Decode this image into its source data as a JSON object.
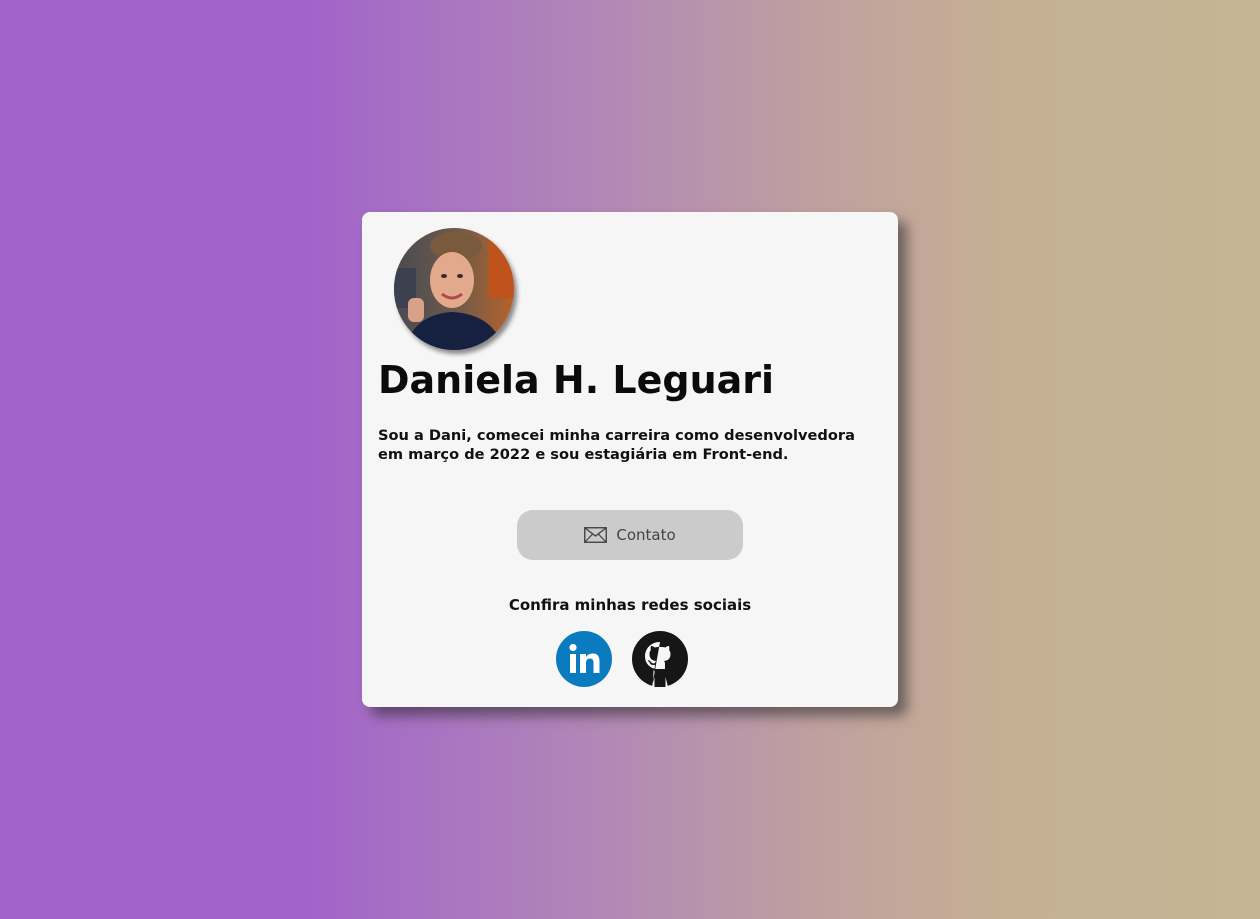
{
  "profile": {
    "name": "Daniela H. Leguari",
    "bio": "Sou a Dani, comecei minha carreira como desenvolvedora em março de 2022 e sou estagiária em Front-end.",
    "avatar_alt": "profile-photo"
  },
  "contact": {
    "label": "Contato",
    "icon": "mail-icon"
  },
  "social": {
    "title": "Confira minhas redes sociais",
    "links": [
      {
        "name": "LinkedIn",
        "icon": "linkedin-icon",
        "color": "#0a7bbf"
      },
      {
        "name": "GitHub",
        "icon": "github-icon",
        "color": "#161616"
      }
    ]
  },
  "colors": {
    "background_left": "#a163ca",
    "background_right": "#c6b495",
    "card": "#f6f6f6",
    "button": "#cbcbcb"
  }
}
